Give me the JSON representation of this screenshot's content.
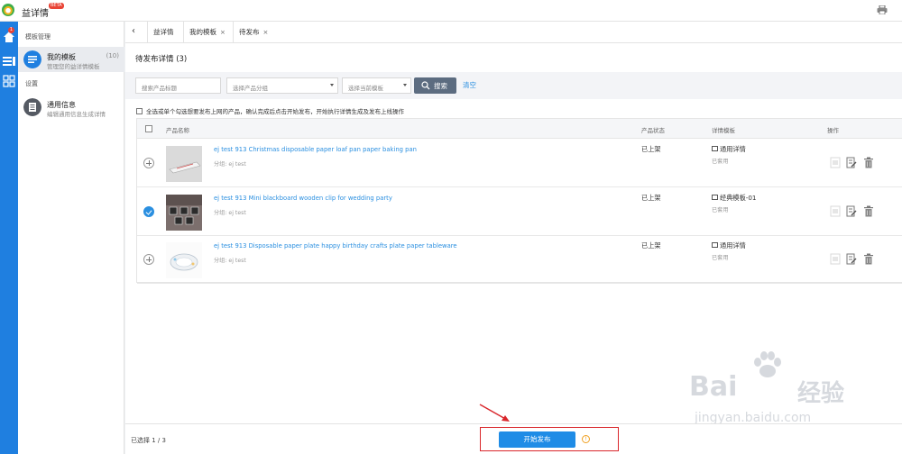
{
  "app": {
    "title": "益详情",
    "badge": "BETA"
  },
  "rail": {
    "home_badge": "1"
  },
  "sidebar": {
    "section1_label": "模板管理",
    "items": [
      {
        "title": "我的模板",
        "subtitle": "管理您的益详情模板",
        "count": "(10)"
      },
      {
        "title": "通用信息",
        "subtitle": "编辑通用信息生成详情"
      }
    ],
    "section2_label": "设置"
  },
  "tabs": [
    {
      "label": "益详情"
    },
    {
      "label": "我的模板",
      "close": "×"
    },
    {
      "label": "待发布",
      "close": "×"
    }
  ],
  "page": {
    "title": "待发布详情 (3)"
  },
  "filters": {
    "title_placeholder": "搜索产品标题",
    "group_placeholder": "选择产品分组",
    "template_placeholder": "选择当前模板",
    "search_label": "搜索",
    "clear_label": "清空"
  },
  "hint": "全选或单个勾选想要发布上网的产品，确认完成后点击开始发布，开始执行详情生成及发布上线操作",
  "table": {
    "headers": {
      "name": "产品名称",
      "status": "产品状态",
      "template": "详情模板",
      "actions": "操作"
    },
    "rows": [
      {
        "name": "ej test 913 Christmas disposable paper loaf pan paper baking pan",
        "group": "分组: ej test",
        "status": "已上架",
        "template": "通用详情",
        "template_sub": "已套用",
        "selected": false
      },
      {
        "name": "ej test 913 Mini blackboard wooden clip for wedding party",
        "group": "分组: ej test",
        "status": "已上架",
        "template": "经典模板-01",
        "template_sub": "已套用",
        "selected": true
      },
      {
        "name": "ej test 913 Disposable paper plate happy birthday crafts plate paper tableware",
        "group": "分组: ej test",
        "status": "已上架",
        "template": "通用详情",
        "template_sub": "已套用",
        "selected": false
      }
    ]
  },
  "footer": {
    "selected_count": "已选择 1 / 3",
    "publish_label": "开始发布",
    "info_mark": "!"
  },
  "watermark": {
    "brand": "Bai",
    "brand_cn": "经验",
    "url": "jingyan.baidu.com"
  },
  "colors": {
    "accent": "#1f8ce6",
    "rail": "#1f7fe0",
    "link": "#2a8fe0",
    "highlight": "#d9262b"
  }
}
